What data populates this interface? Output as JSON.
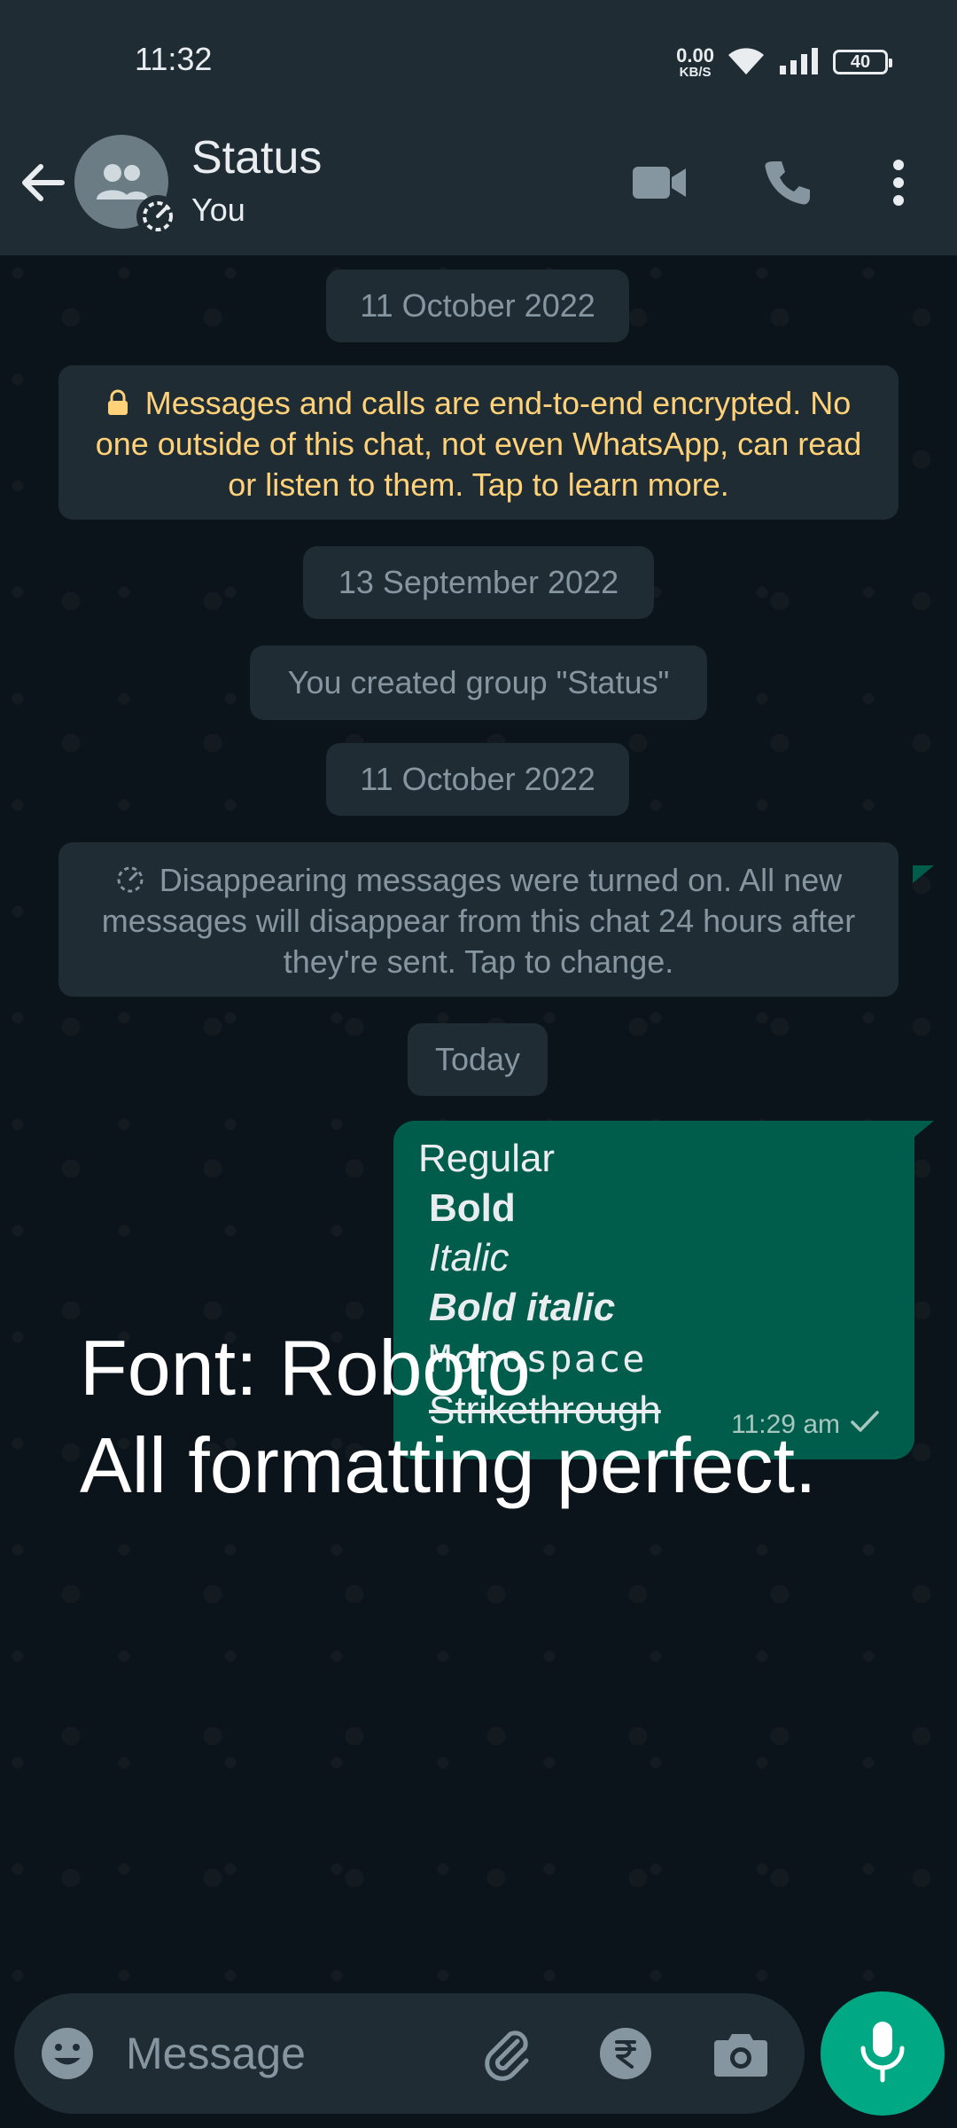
{
  "status_bar": {
    "time": "11:32",
    "net_speed": "0.00",
    "net_unit": "KB/S",
    "battery": "40",
    "icons": [
      "wifi-icon",
      "signal-icon",
      "battery-icon"
    ]
  },
  "header": {
    "title": "Status",
    "subtitle": "You",
    "icons": [
      "back-arrow-icon",
      "group-avatar-icon",
      "disappearing-timer-icon",
      "video-call-icon",
      "voice-call-icon",
      "more-options-icon"
    ]
  },
  "chat": {
    "date_1": "11 October 2022",
    "encryption_notice": "Messages and calls are end-to-end encrypted. No one outside of this chat, not even WhatsApp, can read or listen to them. Tap to learn more.",
    "date_2": "13 September 2022",
    "group_created": "You created group \"Status\"",
    "date_3": "11 October 2022",
    "disappearing_notice": "Disappearing messages were turned on. All new messages will disappear from this chat 24 hours after they're sent. Tap to change.",
    "date_4": "Today",
    "message": {
      "regular": "Regular",
      "bold": "Bold",
      "italic": "Italic",
      "bold_italic": "Bold italic",
      "monospace": "Monospace",
      "strikethrough": "Strikethrough",
      "time": "11:29 am"
    },
    "overlay_line_1": "Font: Roboto",
    "overlay_line_2": "All formatting perfect."
  },
  "composer": {
    "placeholder": "Message",
    "icons": [
      "emoji-icon",
      "attach-icon",
      "payment-icon",
      "camera-icon",
      "mic-icon"
    ]
  },
  "colors": {
    "header_bg": "#1f2c34",
    "chat_bg": "#0b141a",
    "outgoing_bubble": "#005c4b",
    "accent": "#00a884",
    "encryption_text": "#ffd279"
  }
}
